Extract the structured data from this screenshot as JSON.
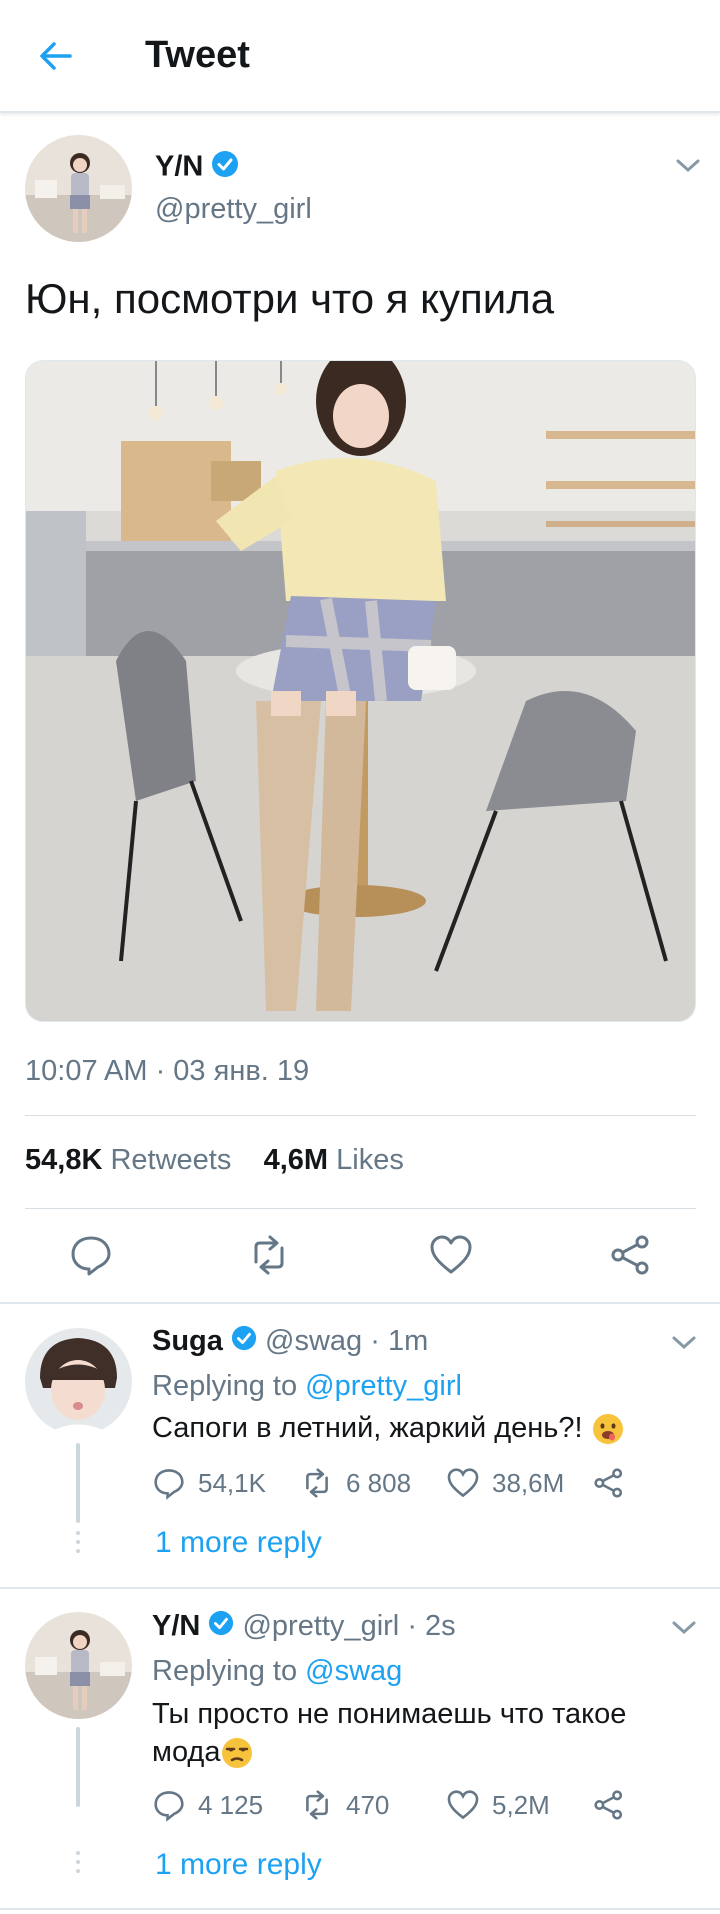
{
  "header": {
    "title": "Tweet",
    "back_icon": "arrow-left-icon"
  },
  "colors": {
    "accent": "#1da1f2",
    "muted": "#657786",
    "text": "#14171a",
    "divider": "#e1e8ed"
  },
  "tweet": {
    "name": "Y/N",
    "handle": "@pretty_girl",
    "text": "Юн, посмотри что я купила",
    "timestamp": "10:07 AM · 03 янв. 19",
    "retweets_count": "54,8K",
    "retweets_label": "Retweets",
    "likes_count": "4,6M",
    "likes_label": "Likes",
    "actions": [
      "reply-icon",
      "retweet-icon",
      "heart-icon",
      "share-icon"
    ]
  },
  "replies": [
    {
      "name": "Suga",
      "handle": "@swag",
      "time": "· 1m",
      "replying_prefix": "Replying to",
      "replying_to": "@pretty_girl",
      "text": "Сапоги в летний, жаркий день?!",
      "reply_count": "54,1K",
      "retweet_count": "6 808",
      "like_count": "38,6M",
      "more": "1 more reply",
      "emoji": "drooling-face-emoji"
    },
    {
      "name": "Y/N",
      "handle": "@pretty_girl",
      "time": "· 2s",
      "replying_prefix": "Replying to",
      "replying_to": "@swag",
      "text_line1": "Ты просто не понимаешь что такое",
      "text_line2": "мода",
      "reply_count": "4 125",
      "retweet_count": "470",
      "like_count": "5,2M",
      "more": "1 more reply",
      "emoji": "unamused-face-emoji"
    }
  ]
}
